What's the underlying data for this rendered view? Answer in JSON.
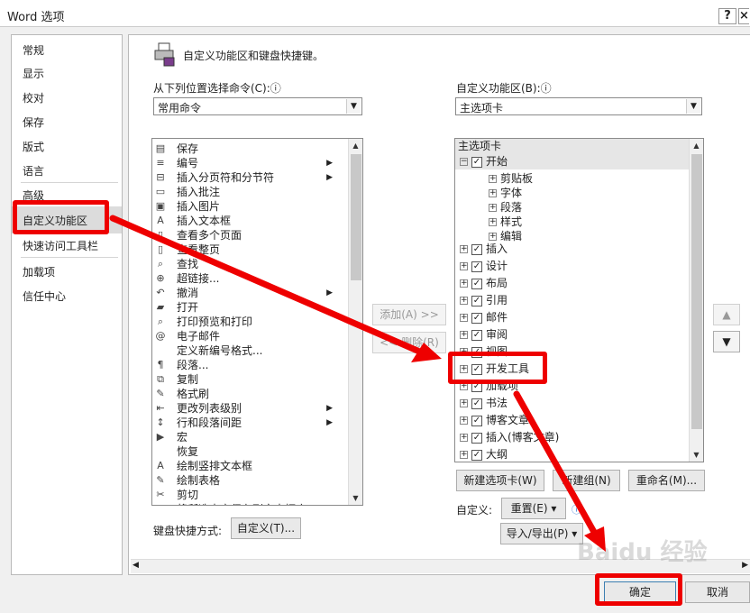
{
  "window": {
    "title": "Word 选项",
    "help_label": "?",
    "close_label": "×"
  },
  "nav": {
    "items": [
      "常规",
      "显示",
      "校对",
      "保存",
      "版式",
      "语言",
      "高级",
      "自定义功能区",
      "快速访问工具栏",
      "加载项",
      "信任中心"
    ]
  },
  "header": {
    "title": "自定义功能区和键盘快捷键。"
  },
  "commands": {
    "label": "从下列位置选择命令(C):ⓘ",
    "source": "常用命令",
    "items": [
      {
        "label": "保存",
        "icon": "save-icon",
        "glyph": "▤",
        "sub": false
      },
      {
        "label": "编号",
        "icon": "numbering-icon",
        "glyph": "≡",
        "sub": true
      },
      {
        "label": "插入分页符和分节符",
        "icon": "page-break-icon",
        "glyph": "⊟",
        "sub": true
      },
      {
        "label": "插入批注",
        "icon": "comment-icon",
        "glyph": "▭",
        "sub": false
      },
      {
        "label": "插入图片",
        "icon": "picture-icon",
        "glyph": "▣",
        "sub": false
      },
      {
        "label": "插入文本框",
        "icon": "textbox-icon",
        "glyph": "A",
        "sub": false
      },
      {
        "label": "查看多个页面",
        "icon": "multi-page-icon",
        "glyph": "▯",
        "sub": false
      },
      {
        "label": "查看整页",
        "icon": "one-page-icon",
        "glyph": "▯",
        "sub": false
      },
      {
        "label": "查找",
        "icon": "find-icon",
        "glyph": "⌕",
        "sub": false
      },
      {
        "label": "超链接...",
        "icon": "hyperlink-icon",
        "glyph": "⊕",
        "sub": false
      },
      {
        "label": "撤消",
        "icon": "undo-icon",
        "glyph": "↶",
        "sub": true
      },
      {
        "label": "打开",
        "icon": "open-icon",
        "glyph": "▰",
        "sub": false
      },
      {
        "label": "打印预览和打印",
        "icon": "print-preview-icon",
        "glyph": "⌕",
        "sub": false
      },
      {
        "label": "电子邮件",
        "icon": "email-icon",
        "glyph": "@",
        "sub": false
      },
      {
        "label": "定义新编号格式...",
        "icon": "",
        "glyph": "",
        "sub": false
      },
      {
        "label": "段落...",
        "icon": "paragraph-icon",
        "glyph": "¶",
        "sub": false
      },
      {
        "label": "复制",
        "icon": "copy-icon",
        "glyph": "⧉",
        "sub": false
      },
      {
        "label": "格式刷",
        "icon": "format-painter-icon",
        "glyph": "✎",
        "sub": false
      },
      {
        "label": "更改列表级别",
        "icon": "list-level-icon",
        "glyph": "⇤",
        "sub": true
      },
      {
        "label": "行和段落间距",
        "icon": "line-spacing-icon",
        "glyph": "↕",
        "sub": true
      },
      {
        "label": "宏",
        "icon": "macro-icon",
        "glyph": "▶",
        "sub": false
      },
      {
        "label": "恢复",
        "icon": "",
        "glyph": "",
        "sub": false
      },
      {
        "label": "绘制竖排文本框",
        "icon": "vertical-textbox-icon",
        "glyph": "A",
        "sub": false
      },
      {
        "label": "绘制表格",
        "icon": "draw-table-icon",
        "glyph": "✎",
        "sub": false
      },
      {
        "label": "剪切",
        "icon": "cut-icon",
        "glyph": "✂",
        "sub": false
      },
      {
        "label": "将所选内容保存到文本框库",
        "icon": "",
        "glyph": "",
        "sub": false
      }
    ]
  },
  "ribbon": {
    "label": "自定义功能区(B):ⓘ",
    "source": "主选项卡",
    "list_header": "主选项卡",
    "start_tab": "开始",
    "start_groups": [
      "剪贴板",
      "字体",
      "段落",
      "样式",
      "编辑"
    ],
    "tabs": [
      "插入",
      "设计",
      "布局",
      "引用",
      "邮件",
      "审阅",
      "视图",
      "开发工具",
      "加载项",
      "书法",
      "博客文章",
      "插入(博客文章)",
      "大纲"
    ]
  },
  "buttons": {
    "add": "添加(A) >>",
    "remove": "<< 删除(R)",
    "new_tab": "新建选项卡(W)",
    "new_group": "新建组(N)",
    "rename": "重命名(M)...",
    "customize_label": "自定义:",
    "reset": "重置(E) ▾",
    "import_export": "导入/导出(P) ▾",
    "keyboard_label": "键盘快捷方式:",
    "customize": "自定义(T)...",
    "ok": "确定",
    "cancel": "取消",
    "move_up": "▲",
    "move_down": "▼"
  },
  "watermark": "Baidu 经验",
  "colors": {
    "highlight": "#e00000",
    "selection": "#cfe3f7"
  }
}
